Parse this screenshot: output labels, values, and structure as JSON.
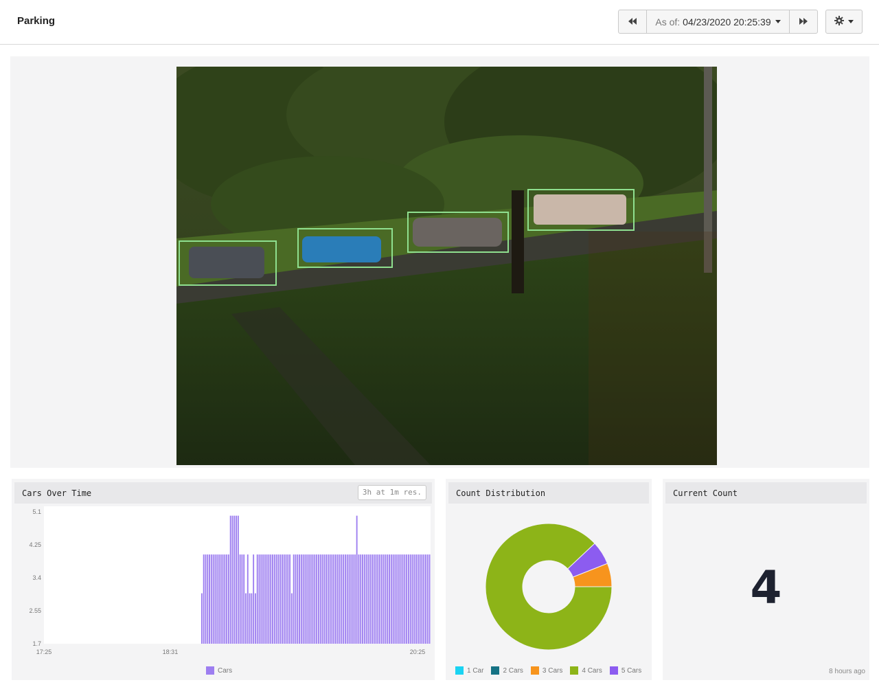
{
  "header": {
    "title": "Parking",
    "as_of_label": "As of:",
    "as_of_value": "04/23/2020 20:25:39",
    "prev_icon": "rewind-icon",
    "next_icon": "fast-forward-icon",
    "settings_icon": "gear-icon"
  },
  "camera": {
    "detection_color": "#8fe08f"
  },
  "cars_over_time": {
    "title": "Cars Over Time",
    "resolution": "3h at 1m res.",
    "legend_label": "Cars",
    "color": "#9d7ef0"
  },
  "count_distribution": {
    "title": "Count Distribution",
    "legend": [
      {
        "label": "1 Car",
        "color": "#1ad3f2"
      },
      {
        "label": "2 Cars",
        "color": "#157284"
      },
      {
        "label": "3 Cars",
        "color": "#f7941d"
      },
      {
        "label": "4 Cars",
        "color": "#8db418"
      },
      {
        "label": "5 Cars",
        "color": "#8c5cf0"
      }
    ]
  },
  "current_count": {
    "title": "Current Count",
    "value": "4",
    "updated": "8 hours ago"
  },
  "chart_data": [
    {
      "type": "bar",
      "title": "Cars Over Time",
      "x_tick_labels": [
        "17:25",
        "18:31",
        "20:25"
      ],
      "y_tick_labels": [
        "5.1",
        "4.25",
        "3.4",
        "2.55",
        "1.7"
      ],
      "ylim": [
        1.7,
        5.1
      ],
      "series": [
        {
          "name": "Cars",
          "values": [
            3,
            4,
            4,
            4,
            4,
            4,
            4,
            4,
            4,
            4,
            4,
            4,
            4,
            4,
            4,
            5,
            5,
            5,
            5,
            5,
            4,
            4,
            4,
            3,
            4,
            3,
            3,
            4,
            3,
            4,
            4,
            4,
            4,
            4,
            4,
            4,
            4,
            4,
            4,
            4,
            4,
            4,
            4,
            4,
            4,
            4,
            4,
            3,
            4,
            4,
            4,
            4,
            4,
            4,
            4,
            4,
            4,
            4,
            4,
            4,
            4,
            4,
            4,
            4,
            4,
            4,
            4,
            4,
            4,
            4,
            4,
            4,
            4,
            4,
            4,
            4,
            4,
            4,
            4,
            4,
            4,
            5,
            4,
            4,
            4,
            4,
            4,
            4,
            4,
            4,
            4,
            4,
            4,
            4,
            4,
            4,
            4,
            4,
            4,
            4,
            4,
            4,
            4,
            4,
            4,
            4,
            4,
            4,
            4,
            4,
            4,
            4,
            4,
            4,
            4,
            4,
            4,
            4,
            4,
            4
          ]
        }
      ]
    },
    {
      "type": "pie",
      "title": "Count Distribution",
      "categories": [
        "1 Car",
        "2 Cars",
        "3 Cars",
        "4 Cars",
        "5 Cars"
      ],
      "values": [
        0,
        0,
        6,
        88,
        6
      ]
    }
  ]
}
